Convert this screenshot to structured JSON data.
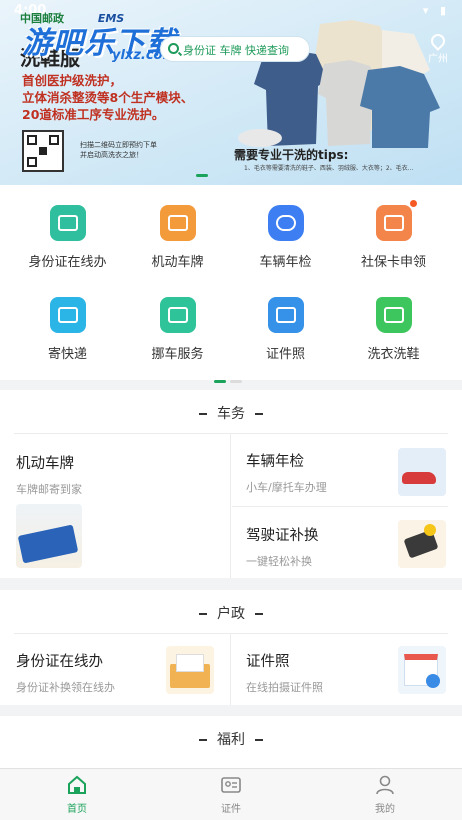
{
  "status_bar": {
    "time": "4:00",
    "icons": "▾ ▮"
  },
  "banner": {
    "logo_text": "中国邮政",
    "logo_ems": "EMS",
    "watermark": "游吧乐下载",
    "watermark_sub": "ylxz.com",
    "title": "洗鞋服",
    "lines": [
      "首创医护级洗护，",
      "立体消杀整烫等8个生产模块、",
      "20道标准工序专业洗护。"
    ],
    "qr_text": [
      "扫描二维码立即预约下单",
      "并启动高洗衣之旅！"
    ],
    "search_text": "身份证 车牌 快递查询",
    "location": "广州",
    "tips": "需要专业干洗的tips:",
    "tips_sub": "1、毛衣等需要清洗的鞋子、西装、羽绒服、大衣等；2、毛衣..."
  },
  "grid": [
    {
      "label": "身份证在线办",
      "icon": "id-card-icon",
      "color": "#2fbf9f"
    },
    {
      "label": "机动车牌",
      "icon": "license-plate-icon",
      "color": "#f39a3b"
    },
    {
      "label": "车辆年检",
      "icon": "car-inspection-icon",
      "color": "#3d7ff2"
    },
    {
      "label": "社保卡申领",
      "icon": "social-security-icon",
      "color": "#f3854a"
    },
    {
      "label": "寄快递",
      "icon": "express-icon",
      "color": "#2bb4e6"
    },
    {
      "label": "挪车服务",
      "icon": "move-car-icon",
      "color": "#2fc39a"
    },
    {
      "label": "证件照",
      "icon": "id-photo-icon",
      "color": "#3592e8"
    },
    {
      "label": "洗衣洗鞋",
      "icon": "laundry-icon",
      "color": "#3ec65e"
    }
  ],
  "sections": {
    "vehicle": {
      "title": "车务",
      "cards": [
        {
          "title": "机动车牌",
          "sub": "车牌邮寄到家"
        },
        {
          "title": "车辆年检",
          "sub": "小车/摩托车办理"
        },
        {
          "title": "驾驶证补换",
          "sub": "一键轻松补换"
        }
      ]
    },
    "household": {
      "title": "户政",
      "cards": [
        {
          "title": "身份证在线办",
          "sub": "身份证补换领在线办"
        },
        {
          "title": "证件照",
          "sub": "在线拍摄证件照"
        }
      ]
    },
    "welfare": {
      "title": "福利"
    }
  },
  "tabs": [
    {
      "label": "首页",
      "icon": "home-icon"
    },
    {
      "label": "证件",
      "icon": "id-document-icon"
    },
    {
      "label": "我的",
      "icon": "profile-icon"
    }
  ],
  "colors": {
    "accent": "#1ca35b",
    "red_text": "#c03020"
  }
}
